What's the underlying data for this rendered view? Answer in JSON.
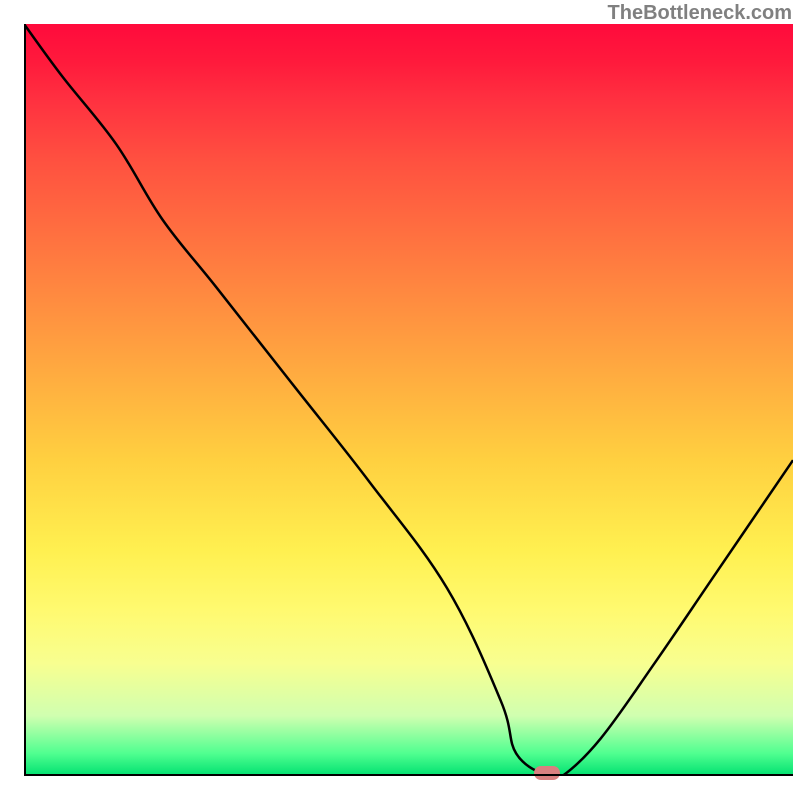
{
  "watermark": "TheBottleneck.com",
  "chart_data": {
    "type": "line",
    "title": "",
    "xlabel": "",
    "ylabel": "",
    "xlim": [
      0,
      100
    ],
    "ylim": [
      0,
      100
    ],
    "series": [
      {
        "name": "bottleneck-curve",
        "x": [
          0,
          5,
          12,
          18,
          25,
          35,
          45,
          55,
          62,
          64,
          68,
          70,
          75,
          82,
          90,
          100
        ],
        "values": [
          100,
          93,
          84,
          74,
          65,
          52,
          39,
          25,
          10,
          3,
          0,
          0,
          5,
          15,
          27,
          42
        ]
      }
    ],
    "marker": {
      "x": 68,
      "y": 0,
      "label": "optimal-point"
    },
    "gradient_stops": [
      {
        "pos": 0,
        "color": "#ff0a3c"
      },
      {
        "pos": 50,
        "color": "#ffc040"
      },
      {
        "pos": 80,
        "color": "#fff060"
      },
      {
        "pos": 100,
        "color": "#00e070"
      }
    ]
  }
}
